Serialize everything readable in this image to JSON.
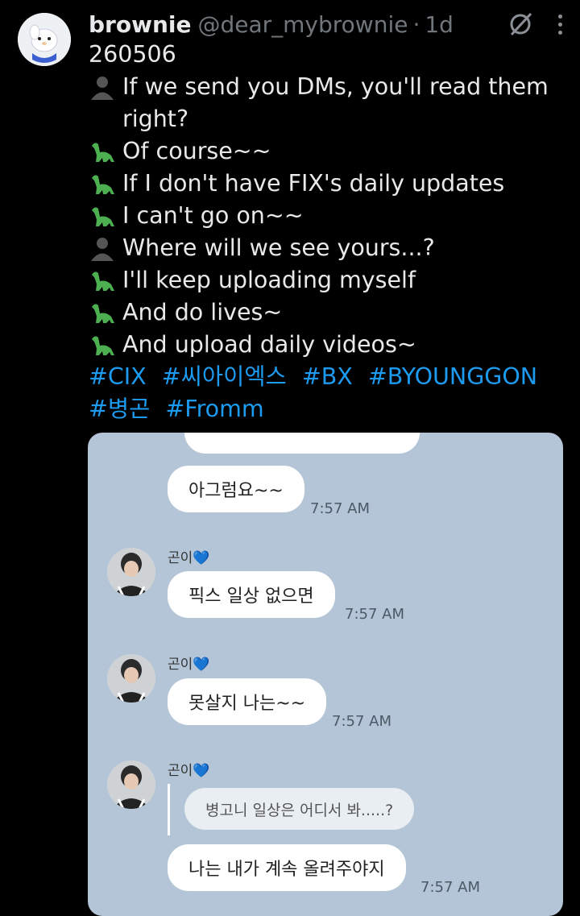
{
  "tweet": {
    "author_name": "brownie",
    "handle": "@dear_mybrownie",
    "separator": "·",
    "time": "1d",
    "grok_icon": "slashed-circle-icon",
    "more_icon": "vertical-dots-icon",
    "date_line": "260506",
    "lines": [
      {
        "icon": "person-silhouette-icon",
        "text": "If we send you DMs, you'll read them right?"
      },
      {
        "icon": "sauropod-icon",
        "text": "Of course~~"
      },
      {
        "icon": "sauropod-icon",
        "text": "If I don't have FIX's daily updates"
      },
      {
        "icon": "sauropod-icon",
        "text": "I can't go on~~"
      },
      {
        "icon": "person-silhouette-icon",
        "text": "Where will we see yours...?"
      },
      {
        "icon": "sauropod-icon",
        "text": "I'll keep uploading myself"
      },
      {
        "icon": "sauropod-icon",
        "text": "And do lives~"
      },
      {
        "icon": "sauropod-icon",
        "text": "And upload daily videos~"
      }
    ],
    "hashtags": [
      "#CIX",
      "#씨아이엑스",
      "#BX",
      "#BYOUNGGON",
      "#병곤",
      "#Fromm"
    ],
    "hashtag_color": "#1d9bf0"
  },
  "chat": {
    "background": "#b3c5d6",
    "sender_name": "곤이💙",
    "messages": [
      {
        "text": "아그럼요~~",
        "time": "7:57 AM"
      },
      {
        "text": "픽스 일상 없으면",
        "time": "7:57 AM"
      },
      {
        "text": "못살지 나는~~",
        "time": "7:57 AM"
      },
      {
        "quoted": "병고니 일상은 어디서 봐.....?",
        "text": "나는 내가 계속 올려주야지",
        "time": "7:57 AM"
      }
    ]
  }
}
